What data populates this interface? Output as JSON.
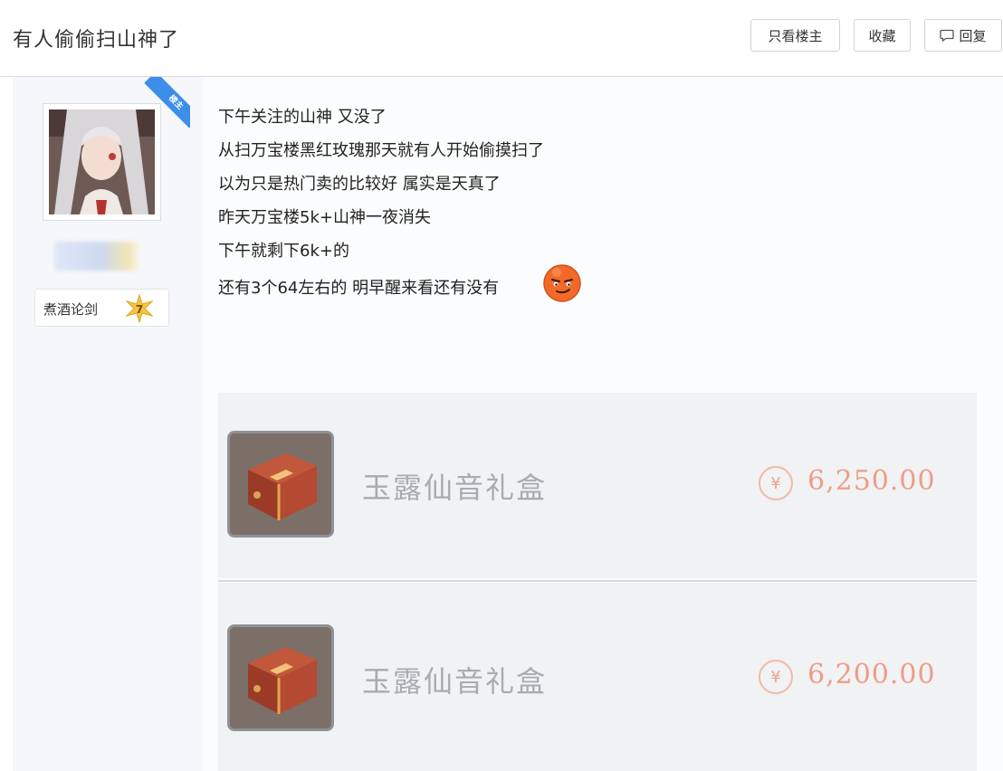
{
  "header": {
    "title": "有人偷偷扫山神了",
    "btn_only_op": "只看楼主",
    "btn_favorite": "收藏",
    "btn_reply": "回复"
  },
  "author": {
    "badge": "楼主",
    "level_name": "煮酒论剑",
    "level_number": "7"
  },
  "post": {
    "lines": [
      "下午关注的山神 又没了",
      "从扫万宝楼黑红玫瑰那天就有人开始偷摸扫了",
      "以为只是热门卖的比较好 属实是天真了",
      "昨天万宝楼5k+山神一夜消失",
      "下午就剩下6k+的",
      "还有3个64左右的 明早醒来看还有没有"
    ]
  },
  "items": [
    {
      "name": "玉露仙音礼盒",
      "currency_symbol": "¥",
      "price": "6,250.00"
    },
    {
      "name": "玉露仙音礼盒",
      "currency_symbol": "¥",
      "price": "6,200.00"
    }
  ],
  "colors": {
    "accent_blue": "#3c8ee8",
    "price_color": "#ee9d86"
  }
}
